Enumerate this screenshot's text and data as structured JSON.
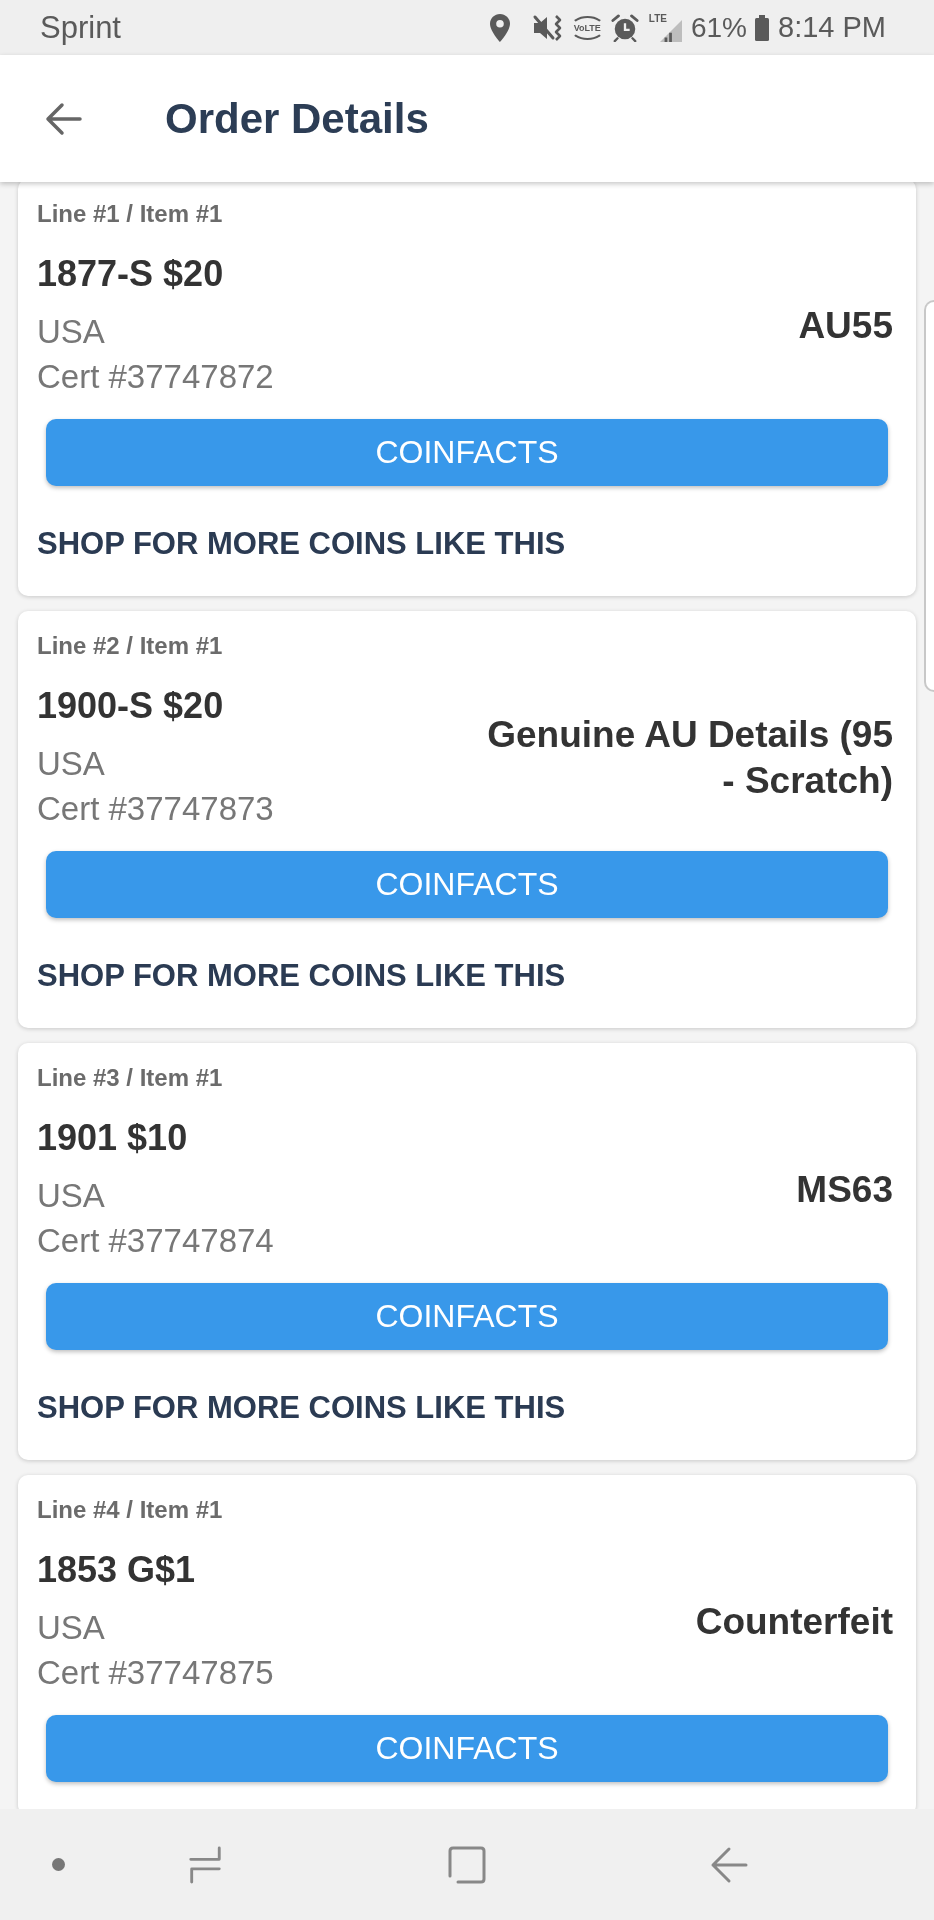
{
  "status_bar": {
    "carrier": "Sprint",
    "volte": "VoLTE",
    "network": "LTE",
    "battery": "61%",
    "time": "8:14 PM"
  },
  "header": {
    "title": "Order Details"
  },
  "items": [
    {
      "line_label": "Line #1 / Item #1",
      "title": "1877-S $20",
      "country": "USA",
      "cert": "Cert #37747872",
      "grade": "AU55",
      "button": "COINFACTS",
      "link": "SHOP FOR MORE COINS LIKE THIS"
    },
    {
      "line_label": "Line #2 / Item #1",
      "title": "1900-S $20",
      "country": "USA",
      "cert": "Cert #37747873",
      "grade": "Genuine AU Details (95 - Scratch)",
      "button": "COINFACTS",
      "link": "SHOP FOR MORE COINS LIKE THIS"
    },
    {
      "line_label": "Line #3 / Item #1",
      "title": "1901 $10",
      "country": "USA",
      "cert": "Cert #37747874",
      "grade": "MS63",
      "button": "COINFACTS",
      "link": "SHOP FOR MORE COINS LIKE THIS"
    },
    {
      "line_label": "Line #4 / Item #1",
      "title": "1853 G$1",
      "country": "USA",
      "cert": "Cert #37747875",
      "grade": "Counterfeit",
      "button": "COINFACTS"
    }
  ]
}
